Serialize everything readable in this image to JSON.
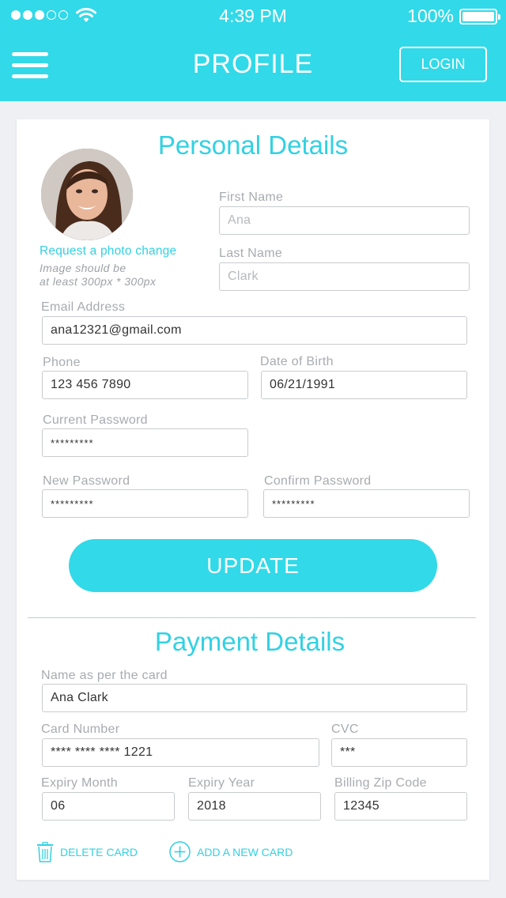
{
  "status_bar": {
    "time": "4:39 PM",
    "battery": "100%"
  },
  "nav": {
    "title": "PROFILE",
    "login_label": "LOGIN"
  },
  "personal": {
    "title": "Personal Details",
    "photo_link": "Request a photo change",
    "photo_hint_line1": "Image should be",
    "photo_hint_line2": "at least 300px * 300px",
    "first_name_label": "First Name",
    "first_name_placeholder": "Ana",
    "last_name_label": "Last Name",
    "last_name_placeholder": "Clark",
    "email_label": "Email Address",
    "email_value": "ana12321@gmail.com",
    "phone_label": "Phone",
    "phone_value": "123 456 7890",
    "dob_label": "Date of Birth",
    "dob_value": "06/21/1991",
    "current_pw_label": "Current Password",
    "current_pw_value": "*********",
    "new_pw_label": "New Password",
    "new_pw_value": "*********",
    "confirm_pw_label": "Confirm Password",
    "confirm_pw_value": "*********",
    "update_label": "UPDATE"
  },
  "payment": {
    "title": "Payment Details",
    "name_label": "Name as per the card",
    "name_value": "Ana Clark",
    "card_number_label": "Card Number",
    "card_number_value": "**** **** **** 1221",
    "cvc_label": "CVC",
    "cvc_value": "***",
    "expiry_month_label": "Expiry Month",
    "expiry_month_value": "06",
    "expiry_year_label": "Expiry Year",
    "expiry_year_value": "2018",
    "zip_label": "Billing Zip Code",
    "zip_value": "12345",
    "delete_label": "DELETE CARD",
    "add_label": "ADD A NEW CARD"
  },
  "icons": [
    "signal-dots-icon",
    "wifi-icon",
    "battery-icon",
    "hamburger-menu-icon",
    "trash-icon",
    "plus-circle-icon"
  ],
  "colors": {
    "accent": "#32d9e8",
    "background": "#eef0f4",
    "card": "#ffffff"
  }
}
